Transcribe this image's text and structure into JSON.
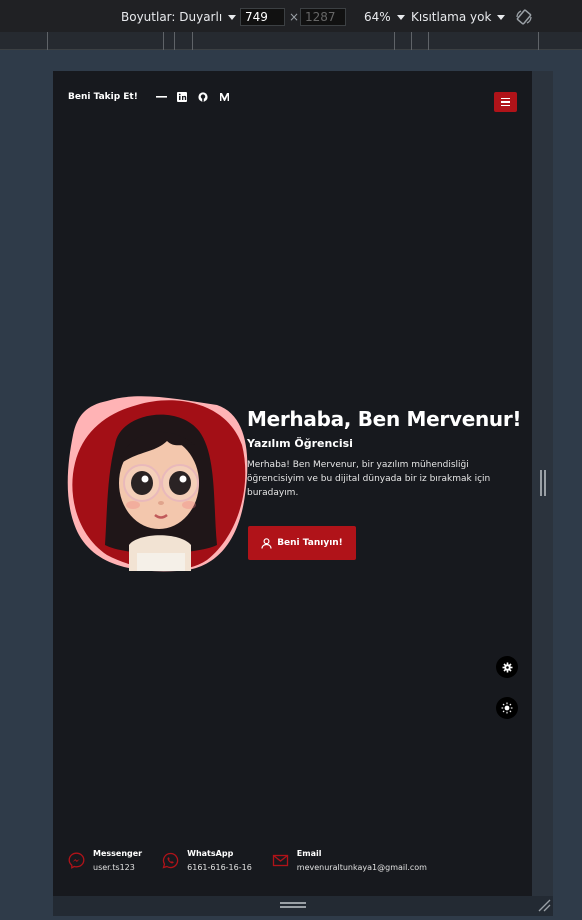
{
  "devtools": {
    "dimensions_label": "Boyutlar: Duyarlı",
    "width": "749",
    "times": "×",
    "height": "1287",
    "zoom": "64%",
    "throttle": "Kısıtlama yok",
    "rotate_icon": "rotate-icon"
  },
  "nav": {
    "follow_label": "Beni Takip Et!",
    "socials": [
      "dash-icon",
      "linkedin-icon",
      "github-icon",
      "medium-icon"
    ],
    "menu_icon": "hamburger-icon"
  },
  "hero": {
    "title": "Merhaba, Ben Mervenur!",
    "subtitle": "Yazılım Öğrencisi",
    "description": "Merhaba! Ben Mervenur, bir yazılım mühendisliği öğrencisiyim ve bu dijital dünyada bir iz bırakmak için buradayım.",
    "cta_label": "Beni Tanıyın!",
    "cta_icon": "user-icon"
  },
  "floating": [
    "gear-icon",
    "sun-icon"
  ],
  "contacts": [
    {
      "label": "Messenger",
      "value": "user.ts123",
      "icon": "messenger-icon"
    },
    {
      "label": "WhatsApp",
      "value": "6161-616-16-16",
      "icon": "whatsapp-icon"
    },
    {
      "label": "Email",
      "value": "mevenuraltunkaya1@gmail.com",
      "icon": "mail-icon"
    }
  ],
  "colors": {
    "accent": "#b01319",
    "page_bg": "#17191e",
    "blob_pink": "#ffb3b5"
  }
}
